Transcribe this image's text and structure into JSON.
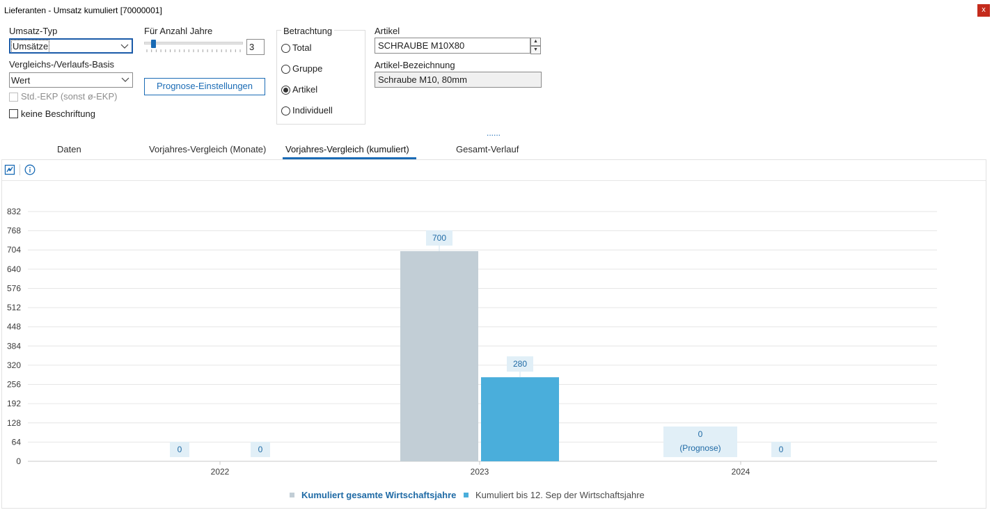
{
  "window": {
    "title": "Lieferanten - Umsatz kumuliert [70000001]",
    "close_label": "x"
  },
  "umsatz_typ": {
    "label": "Umsatz-Typ",
    "value": "Umsätze"
  },
  "basis": {
    "label": "Vergleichs-/Verlaufs-Basis",
    "value": "Wert"
  },
  "std_ekp": {
    "label": "Std.-EKP (sonst ø-EKP)",
    "checked": false,
    "enabled": false
  },
  "keine_beschriftung": {
    "label": "keine Beschriftung",
    "checked": false
  },
  "jahre": {
    "label": "Für Anzahl Jahre",
    "value": "3",
    "slider_fraction": 0.07
  },
  "prognose_button": "Prognose-Einstellungen",
  "betrachtung": {
    "title": "Betrachtung",
    "options": [
      "Total",
      "Gruppe",
      "Artikel",
      "Individuell"
    ],
    "selected": "Artikel"
  },
  "artikel": {
    "label": "Artikel",
    "value": "SCHRAUBE M10X80"
  },
  "artikel_bezeichnung": {
    "label": "Artikel-Bezeichnung",
    "value": "Schraube M10, 80mm"
  },
  "splitter_dots": "......",
  "tabs": [
    "Daten",
    "Vorjahres-Vergleich (Monate)",
    "Vorjahres-Vergleich (kumuliert)",
    "Gesamt-Verlauf"
  ],
  "active_tab": "Vorjahres-Vergleich (kumuliert)",
  "toolbar": {
    "icons": [
      "chart-settings-icon",
      "info-icon"
    ]
  },
  "colors": {
    "series1": "#c2ced6",
    "series2": "#4aaedb",
    "label_bg": "#e1eff7",
    "label_text": "#1f6aa5",
    "accent": "#1a6bb5"
  },
  "chart_data": {
    "type": "bar",
    "categories": [
      "2022",
      "2023",
      "2024"
    ],
    "series": [
      {
        "name": "Kumuliert gesamte Wirtschaftsjahre",
        "values": [
          0,
          700,
          0
        ],
        "labels": [
          "0",
          "700",
          "0\n(Prognose)"
        ]
      },
      {
        "name": "Kumuliert bis 12. Sep der Wirtschaftsjahre",
        "values": [
          0,
          280,
          0
        ],
        "labels": [
          "0",
          "280",
          "0"
        ]
      }
    ],
    "yticks": [
      0,
      64,
      128,
      192,
      256,
      320,
      384,
      448,
      512,
      576,
      640,
      704,
      768,
      832
    ],
    "ylim": [
      0,
      832
    ],
    "grid": true,
    "legend_position": "bottom"
  }
}
